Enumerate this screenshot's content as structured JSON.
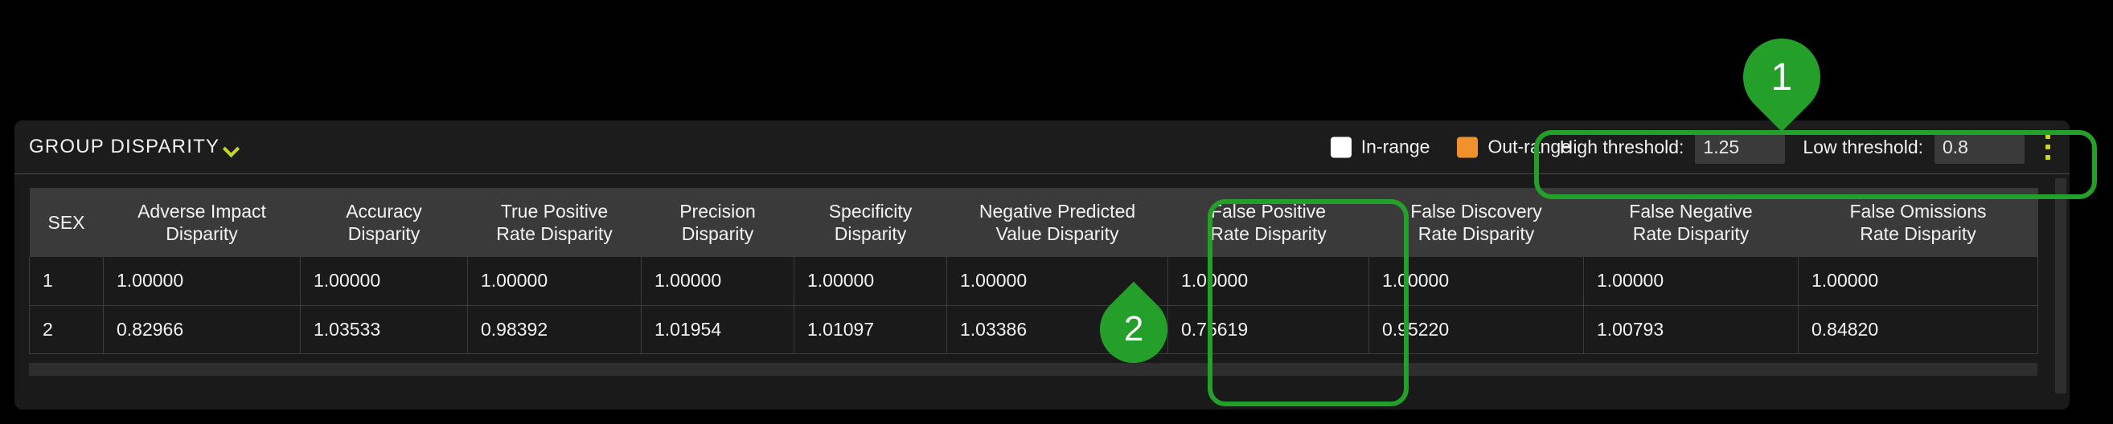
{
  "panel": {
    "title": "GROUP DISPARITY",
    "title_chevron_icon": "chevron-down-icon"
  },
  "legend": {
    "items": [
      {
        "label": "In-range",
        "color": "#ffffff"
      },
      {
        "label": "Out-range",
        "color": "#f0912e"
      }
    ]
  },
  "thresholds": {
    "high_label": "High threshold:",
    "high_value": "1.25",
    "low_label": "Low threshold:",
    "low_value": "0.8",
    "menu_icon": "kebab-menu-icon"
  },
  "table": {
    "headers": [
      "SEX",
      "Adverse Impact\nDisparity",
      "Accuracy\nDisparity",
      "True Positive\nRate Disparity",
      "Precision\nDisparity",
      "Specificity\nDisparity",
      "Negative Predicted\nValue Disparity",
      "False Positive\nRate Disparity",
      "False Discovery\nRate Disparity",
      "False Negative\nRate Disparity",
      "False Omissions\nRate Disparity"
    ],
    "headers_lines": [
      [
        "SEX",
        ""
      ],
      [
        "Adverse Impact",
        "Disparity"
      ],
      [
        "Accuracy",
        "Disparity"
      ],
      [
        "True Positive",
        "Rate Disparity"
      ],
      [
        "Precision",
        "Disparity"
      ],
      [
        "Specificity",
        "Disparity"
      ],
      [
        "Negative Predicted",
        "Value Disparity"
      ],
      [
        "False Positive",
        "Rate Disparity"
      ],
      [
        "False Discovery",
        "Rate Disparity"
      ],
      [
        "False Negative",
        "Rate Disparity"
      ],
      [
        "False Omissions",
        "Rate Disparity"
      ]
    ],
    "rows": [
      {
        "cells": [
          "1",
          "1.00000",
          "1.00000",
          "1.00000",
          "1.00000",
          "1.00000",
          "1.00000",
          "1.00000",
          "1.00000",
          "1.00000",
          "1.00000"
        ],
        "out_of_range": []
      },
      {
        "cells": [
          "2",
          "0.82966",
          "1.03533",
          "0.98392",
          "1.01954",
          "1.01097",
          "1.03386",
          "0.75619",
          "0.95220",
          "1.00793",
          "0.84820"
        ],
        "out_of_range": [
          7
        ]
      }
    ]
  },
  "annotations": {
    "markers": [
      {
        "number": "1",
        "target": "threshold-controls"
      },
      {
        "number": "2",
        "target": "false-positive-rate-disparity-column"
      }
    ],
    "highlight_color": "#24a02a"
  }
}
